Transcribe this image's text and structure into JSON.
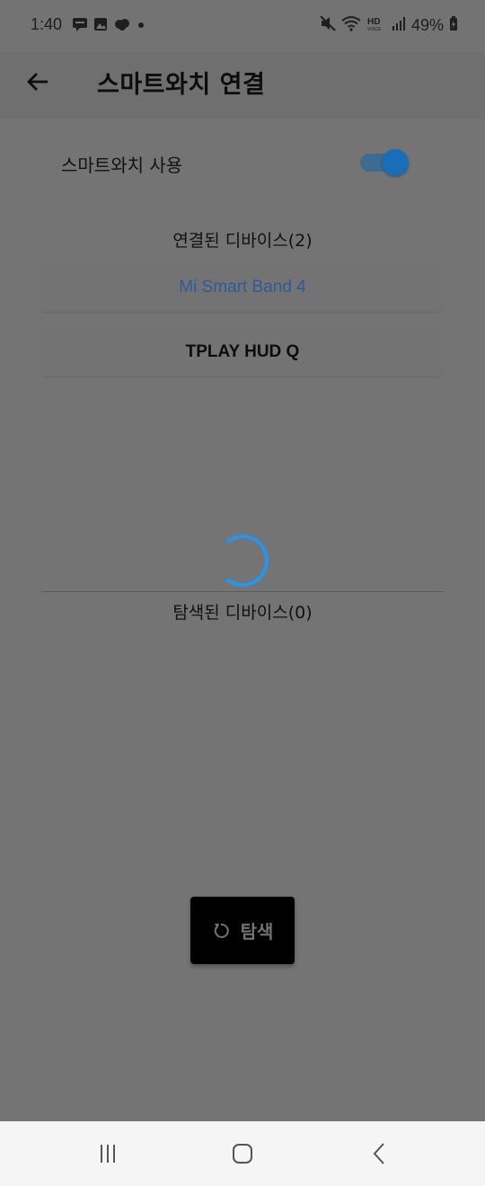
{
  "status_bar": {
    "time": "1:40",
    "battery": "49%",
    "left_icons": [
      "chat-bubble-icon",
      "gallery-icon",
      "cloud-app-icon",
      "notification-dot-icon"
    ],
    "right_icons": [
      "mute-icon",
      "wifi-icon",
      "hd-voice-icon",
      "signal-icon",
      "battery-icon"
    ]
  },
  "app_bar": {
    "back_icon": "arrow-left-icon",
    "title": "스마트와치 연결"
  },
  "smartwatch_toggle": {
    "label": "스마트와치 사용",
    "enabled": true
  },
  "connected_devices": {
    "title": "연결된 디바이스(2)",
    "items": [
      {
        "name": "Mi Smart Band 4"
      },
      {
        "name": "TPLAY HUD Q"
      }
    ]
  },
  "discovered_devices": {
    "title": "탐색된 디바이스(0)",
    "items": []
  },
  "scan_button": {
    "icon": "refresh-icon",
    "label": "탐색"
  },
  "nav_bar": {
    "buttons": [
      "recent-apps-icon",
      "home-icon",
      "back-icon"
    ]
  },
  "colors": {
    "accent": "#1a6db8",
    "active_device_text": "#2e5a9c",
    "spinner": "#2196f3",
    "scrim_background": "#747474"
  }
}
